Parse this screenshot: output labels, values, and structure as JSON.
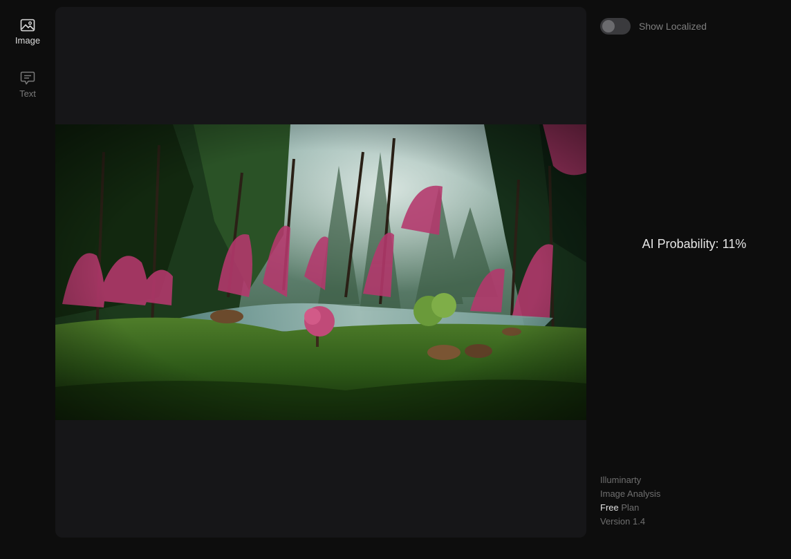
{
  "sidebar": {
    "items": [
      {
        "label": "Image",
        "icon": "image-icon",
        "active": true
      },
      {
        "label": "Text",
        "icon": "chat-message-icon",
        "active": false
      }
    ]
  },
  "canvas": {
    "image_alt": "Fantasy forest landscape painting with pink weeping trees, a river and grazing animals"
  },
  "toggle": {
    "label": "Show Localized",
    "on": false
  },
  "result": {
    "text": "AI Probability: 11%"
  },
  "footer": {
    "app_name": "Illuminarty",
    "mode": "Image Analysis",
    "plan_tier": "Free",
    "plan_suffix": " Plan",
    "version": "Version 1.4"
  },
  "colors": {
    "background": "#0d0d0d",
    "panel": "#161618",
    "active_nav": "#dcdcdc",
    "inactive_nav": "#7a7a7a"
  }
}
